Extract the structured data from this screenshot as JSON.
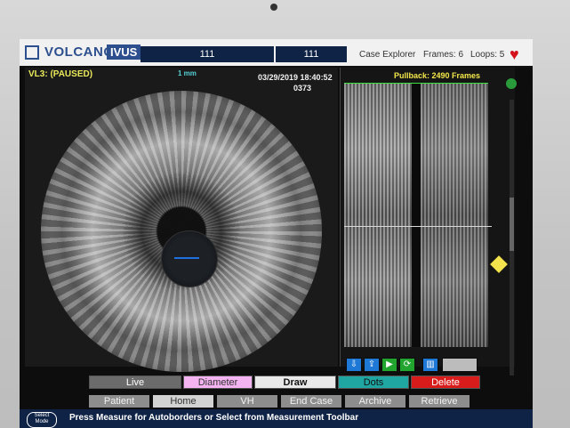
{
  "header": {
    "brand": "VOLCANO",
    "badge": "IVUS",
    "box1": "111",
    "box2": "111",
    "case_explorer": "Case Explorer",
    "frames": "Frames: 6",
    "loops": "Loops: 5"
  },
  "left": {
    "mode_label": "VL3: (PAUSED)",
    "scale": "1 mm",
    "datetime": "03/29/2019 18:40:52",
    "frame_no": "0373"
  },
  "right": {
    "pullback": "Pullback: 2490 Frames"
  },
  "buttons": {
    "live": "Live",
    "diameter": "Diameter",
    "draw": "Draw",
    "dots": "Dots",
    "delete": "Delete"
  },
  "nav": [
    "Patient",
    "Home",
    "VH",
    "End Case",
    "Archive",
    "Retrieve"
  ],
  "status": {
    "select_mode": "Select Mode",
    "message": "Press Measure for Autoborders or Select from Measurement Toolbar"
  },
  "colors": {
    "header_blue": "#0f2347",
    "accent_yellow": "#f3e34c",
    "delete_red": "#d81b1b",
    "diameter_pink": "#f4b4f1",
    "draw_white": "#e9e9e9",
    "dots_teal": "#1fa6a2"
  }
}
